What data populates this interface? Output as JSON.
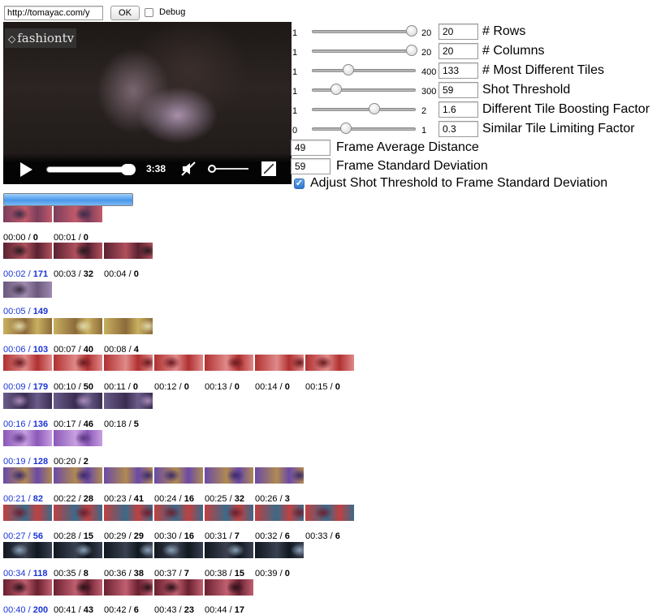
{
  "topbar": {
    "url_value": "http://tomayac.com/y",
    "ok_label": "OK",
    "debug_label": "Debug"
  },
  "video": {
    "logo": "fashiontv",
    "time": "3:38",
    "progress_fraction": 0.92,
    "volume_fraction": 0.1
  },
  "sliders": [
    {
      "min": "1",
      "max": "20",
      "value": "20",
      "label": "# Rows",
      "fraction": 1.0
    },
    {
      "min": "1",
      "max": "20",
      "value": "20",
      "label": "# Columns",
      "fraction": 1.0
    },
    {
      "min": "1",
      "max": "400",
      "value": "133",
      "label": "# Most Different Tiles",
      "fraction": 0.33
    },
    {
      "min": "1",
      "max": "300",
      "value": "59",
      "label": "Shot Threshold",
      "fraction": 0.2
    },
    {
      "min": "1",
      "max": "2",
      "value": "1.6",
      "label": "Different Tile Boosting Factor",
      "fraction": 0.6
    },
    {
      "min": "0",
      "max": "1",
      "value": "0.3",
      "label": "Similar Tile Limiting Factor",
      "fraction": 0.3
    }
  ],
  "fields": [
    {
      "value": "49",
      "label": "Frame Average Distance"
    },
    {
      "value": "59",
      "label": "Frame Standard Deviation"
    }
  ],
  "adjust_label": "Adjust Shot Threshold to Frame Standard Deviation",
  "progress_fraction": 1.0,
  "colors": {
    "shot_label": "#1a33d6",
    "progress_fill": "#4a97e8"
  },
  "rows": [
    {
      "frames": [
        {
          "t": "00:00",
          "d": "0",
          "shot": false
        },
        {
          "t": "00:01",
          "d": "0",
          "shot": false
        }
      ]
    },
    {
      "frames": [
        {
          "t": "00:02",
          "d": "171",
          "shot": true
        },
        {
          "t": "00:03",
          "d": "32",
          "shot": false
        },
        {
          "t": "00:04",
          "d": "0",
          "shot": false
        }
      ]
    },
    {
      "frames": [
        {
          "t": "00:05",
          "d": "149",
          "shot": true
        }
      ]
    },
    {
      "frames": [
        {
          "t": "00:06",
          "d": "103",
          "shot": true
        },
        {
          "t": "00:07",
          "d": "40",
          "shot": false
        },
        {
          "t": "00:08",
          "d": "4",
          "shot": false
        }
      ]
    },
    {
      "frames": [
        {
          "t": "00:09",
          "d": "179",
          "shot": true
        },
        {
          "t": "00:10",
          "d": "50",
          "shot": false
        },
        {
          "t": "00:11",
          "d": "0",
          "shot": false
        },
        {
          "t": "00:12",
          "d": "0",
          "shot": false
        },
        {
          "t": "00:13",
          "d": "0",
          "shot": false
        },
        {
          "t": "00:14",
          "d": "0",
          "shot": false
        },
        {
          "t": "00:15",
          "d": "0",
          "shot": false
        }
      ]
    },
    {
      "frames": [
        {
          "t": "00:16",
          "d": "136",
          "shot": true
        },
        {
          "t": "00:17",
          "d": "46",
          "shot": false
        },
        {
          "t": "00:18",
          "d": "5",
          "shot": false
        }
      ]
    },
    {
      "frames": [
        {
          "t": "00:19",
          "d": "128",
          "shot": true
        },
        {
          "t": "00:20",
          "d": "2",
          "shot": false
        }
      ]
    },
    {
      "frames": [
        {
          "t": "00:21",
          "d": "82",
          "shot": true
        },
        {
          "t": "00:22",
          "d": "28",
          "shot": false
        },
        {
          "t": "00:23",
          "d": "41",
          "shot": false
        },
        {
          "t": "00:24",
          "d": "16",
          "shot": false
        },
        {
          "t": "00:25",
          "d": "32",
          "shot": false
        },
        {
          "t": "00:26",
          "d": "3",
          "shot": false
        }
      ]
    },
    {
      "frames": [
        {
          "t": "00:27",
          "d": "56",
          "shot": true
        },
        {
          "t": "00:28",
          "d": "15",
          "shot": false
        },
        {
          "t": "00:29",
          "d": "29",
          "shot": false
        },
        {
          "t": "00:30",
          "d": "16",
          "shot": false
        },
        {
          "t": "00:31",
          "d": "7",
          "shot": false
        },
        {
          "t": "00:32",
          "d": "6",
          "shot": false
        },
        {
          "t": "00:33",
          "d": "6",
          "shot": false
        }
      ]
    },
    {
      "frames": [
        {
          "t": "00:34",
          "d": "118",
          "shot": true
        },
        {
          "t": "00:35",
          "d": "8",
          "shot": false
        },
        {
          "t": "00:36",
          "d": "38",
          "shot": false
        },
        {
          "t": "00:37",
          "d": "7",
          "shot": false
        },
        {
          "t": "00:38",
          "d": "15",
          "shot": false
        },
        {
          "t": "00:39",
          "d": "0",
          "shot": false
        }
      ]
    },
    {
      "frames": [
        {
          "t": "00:40",
          "d": "200",
          "shot": true
        },
        {
          "t": "00:41",
          "d": "43",
          "shot": false
        },
        {
          "t": "00:42",
          "d": "6",
          "shot": false
        },
        {
          "t": "00:43",
          "d": "23",
          "shot": false
        },
        {
          "t": "00:44",
          "d": "17",
          "shot": false
        }
      ]
    }
  ],
  "thumb_palettes": [
    [
      "#7a3d5c",
      "#c25a6a",
      "#3b2b48"
    ],
    [
      "#5a2232",
      "#b0505c",
      "#2a1b22"
    ],
    [
      "#6b5a7c",
      "#a08ab0",
      "#3a2f44"
    ],
    [
      "#c8b060",
      "#8c6a3a",
      "#e0d8a8"
    ],
    [
      "#b03030",
      "#e08a8a",
      "#6a1a20"
    ],
    [
      "#6a5c8a",
      "#3a2c50",
      "#a88ab8"
    ],
    [
      "#8a58b8",
      "#c8a0e0",
      "#5a3480"
    ],
    [
      "#6a4aa8",
      "#b08a50",
      "#3c2a6a"
    ],
    [
      "#c04040",
      "#3a6a8a",
      "#6a2030"
    ],
    [
      "#101820",
      "#3a4050",
      "#8aa0b8"
    ],
    [
      "#6a2030",
      "#c06070",
      "#2a1018"
    ]
  ]
}
